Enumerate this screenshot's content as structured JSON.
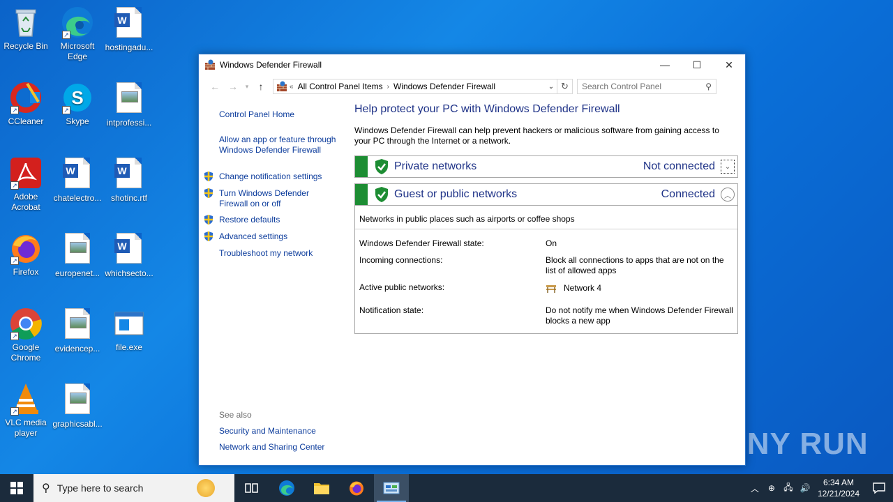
{
  "desktop": {
    "icons": [
      {
        "label": "Recycle Bin"
      },
      {
        "label": "Microsoft Edge"
      },
      {
        "label": "hostingadu..."
      },
      {
        "label": "CCleaner"
      },
      {
        "label": "Skype"
      },
      {
        "label": "intprofessi..."
      },
      {
        "label": "Adobe Acrobat"
      },
      {
        "label": "chatelectro..."
      },
      {
        "label": "shotinc.rtf"
      },
      {
        "label": "Firefox"
      },
      {
        "label": "europenet..."
      },
      {
        "label": "whichsecto..."
      },
      {
        "label": "Google Chrome"
      },
      {
        "label": "evidencep..."
      },
      {
        "label": "file.exe"
      },
      {
        "label": "VLC media player"
      },
      {
        "label": "graphicsabl..."
      }
    ],
    "watermark": "ANY RUN"
  },
  "window": {
    "title": "Windows Defender Firewall",
    "address": {
      "prefix": "«",
      "crumbs": [
        "All Control Panel Items",
        "Windows Defender Firewall"
      ]
    },
    "search_placeholder": "Search Control Panel",
    "left_pane": {
      "home": "Control Panel Home",
      "links": [
        "Allow an app or feature through Windows Defender Firewall",
        "Change notification settings",
        "Turn Windows Defender Firewall on or off",
        "Restore defaults",
        "Advanced settings",
        "Troubleshoot my network"
      ],
      "see_also_label": "See also",
      "see_also": [
        "Security and Maintenance",
        "Network and Sharing Center"
      ]
    },
    "main": {
      "heading": "Help protect your PC with Windows Defender Firewall",
      "description": "Windows Defender Firewall can help prevent hackers or malicious software from gaining access to your PC through the Internet or a network.",
      "private": {
        "name": "Private networks",
        "status": "Not connected"
      },
      "public": {
        "name": "Guest or public networks",
        "status": "Connected",
        "subtitle": "Networks in public places such as airports or coffee shops",
        "details": [
          {
            "label": "Windows Defender Firewall state:",
            "value": "On"
          },
          {
            "label": "Incoming connections:",
            "value": "Block all connections to apps that are not on the list of allowed apps"
          },
          {
            "label": "Active public networks:",
            "value": "Network  4"
          },
          {
            "label": "Notification state:",
            "value": "Do not notify me when Windows Defender Firewall blocks a new app"
          }
        ]
      }
    }
  },
  "taskbar": {
    "search_placeholder": "Type here to search",
    "time": "6:34 AM",
    "date": "12/21/2024"
  },
  "colors": {
    "heading": "#1e3287",
    "link": "#0c3c9c",
    "shield_green": "#1d8d33",
    "taskbar": "#1b2b3c"
  }
}
